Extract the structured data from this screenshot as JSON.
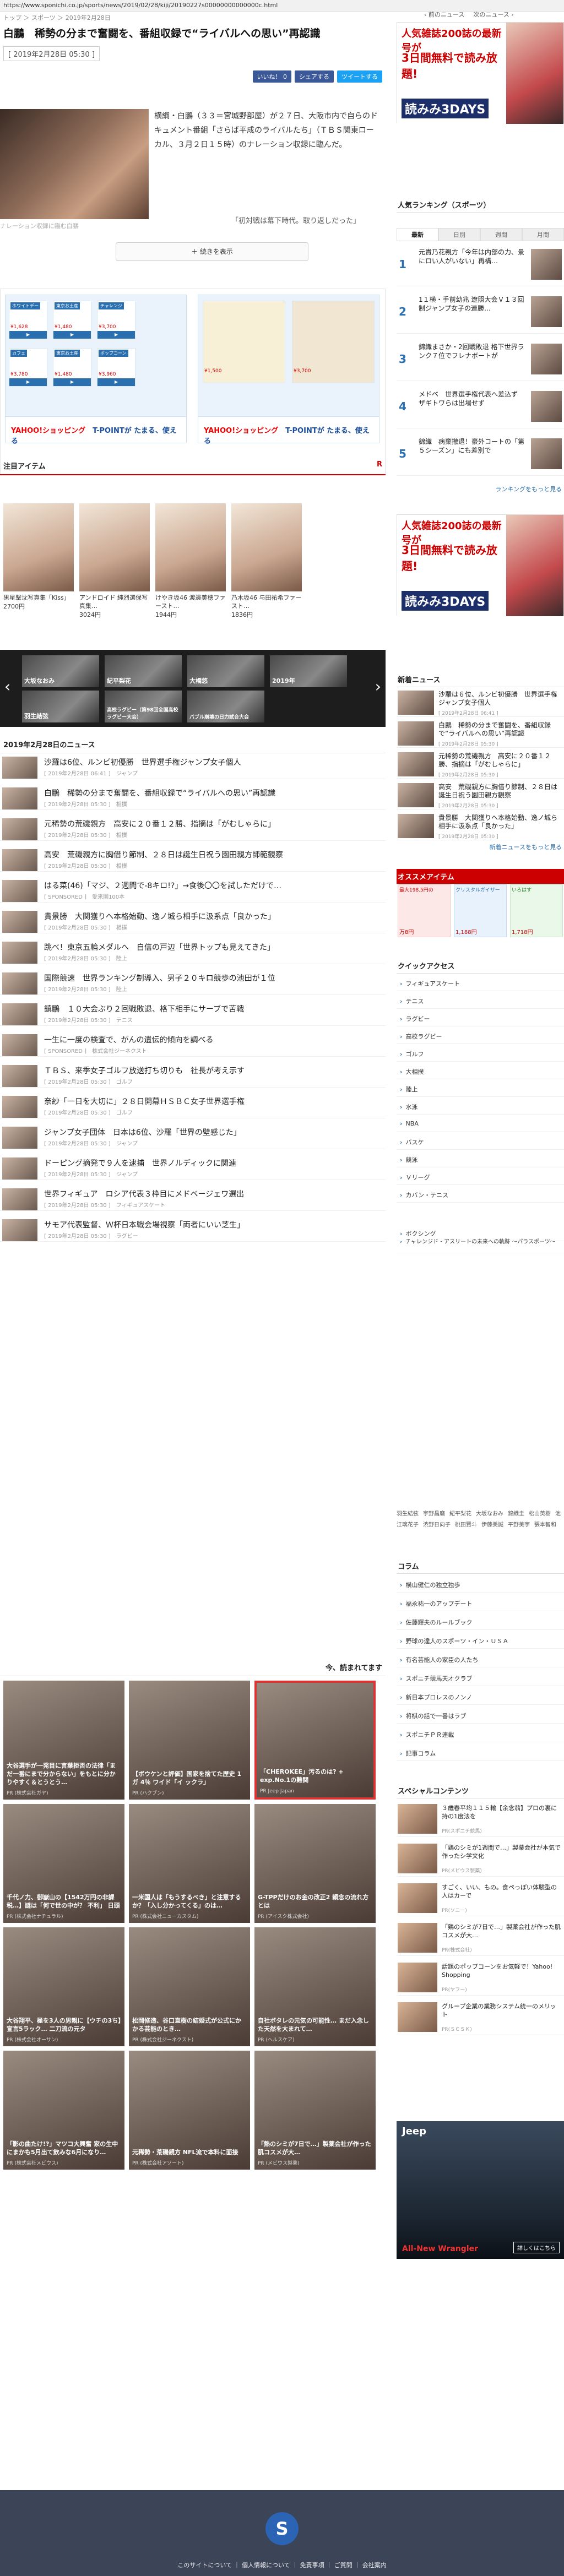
{
  "url": "https://www.sponichi.co.jp/sports/news/2019/02/28/kiji/20190227s00000000000000c.html",
  "breadcrumb": "トップ ＞ スポーツ ＞ 2019年2月28日",
  "topnav": {
    "prev": "前のニュース",
    "next": "次のニュース"
  },
  "article": {
    "title": "白鵬　稀勢の分まで奮闘を、番組収録で“ライバルへの思い”再認識",
    "date": "[ 2019年2月28日 05:30 ]",
    "share": [
      {
        "label": "いいね！ 0",
        "color": "#3b5998"
      },
      {
        "label": "シェアする",
        "color": "#3b5998"
      },
      {
        "label": "ツイートする",
        "color": "#1da1f2"
      }
    ],
    "photo_caption": "ナレーション収録に臨む白鵬",
    "body": "横綱・白鵬（３３＝宮城野部屋）が２７日、大阪市内で自らのドキュメント番組「さらば平成のライバルたち」（ＴＢＳ関東ローカル、３月２日１５時）のナレーション収録に臨んだ。",
    "quote": "「初対戦は幕下時代。取り返しだった」",
    "more_btn": "続きを表示"
  },
  "ads": {
    "left_footer": "YAHOO!ショッピング",
    "left_point": "T-POINTが たまる、使える",
    "right_footer": "YAHOO!ショッピング",
    "right_point": "T-POINTが たまる、使える",
    "tiles": [
      {
        "tag": "ホワイトデー",
        "price": "¥1,628"
      },
      {
        "tag": "東京お土産",
        "price": "¥1,480"
      },
      {
        "tag": "チャレンジ",
        "price": "¥3,700"
      },
      {
        "tag": "カフェ",
        "price": "¥3,780"
      },
      {
        "tag": "東京お土産",
        "price": "¥1,480"
      },
      {
        "tag": "ポップコーン",
        "price": "¥3,960"
      }
    ],
    "right_prices": [
      "¥1,500",
      "¥3,700"
    ]
  },
  "attention": {
    "heading": "注目アイテム",
    "items": [
      {
        "name": "黒星撃沈写真集「Kiss」",
        "price": "2700円"
      },
      {
        "name": "アンドロイド 純烈選保写真集…",
        "price": "3024円"
      },
      {
        "name": "けやき坂46 渡邊美穂ファースト…",
        "price": "1944円"
      },
      {
        "name": "乃木坂46 与田祐希ファースト…",
        "price": "1836円"
      }
    ]
  },
  "slider": {
    "slides": [
      "大坂なおみ",
      "紀平梨花",
      "大橋悠",
      "2019年",
      "羽生結弦",
      "高校ラグビー（第98回全国高校ラグビー大会）",
      "バブル崩壊の日力試合大会"
    ]
  },
  "daily": {
    "heading": "2019年2月28日のニュース",
    "items": [
      {
        "t": "沙羅は6位、ルンビ初優勝　世界選手権ジャンプ女子個人",
        "d": "[ 2019年2月28日 06:41 ]　ジャンプ"
      },
      {
        "t": "白鵬　稀勢の分まで奮闘を、番組収録で“ライバルへの思い”再認識",
        "d": "[ 2019年2月28日 05:30 ]　相撲"
      },
      {
        "t": "元稀勢の荒磯親方　高安に２０番１２勝、指摘は「がむしゃらに」",
        "d": "[ 2019年2月28日 05:30 ]　相撲"
      },
      {
        "t": "高安　荒磯親方に胸借り節制、２８日は誕生日祝う園田親方師範観察",
        "d": "[ 2019年2月28日 05:30 ]　相撲"
      },
      {
        "t": "はる菜(46)「マジ、２週間で-8キロ!?」→食後〇〇を試しただけで…",
        "d": "[ SPONSORED ]　愛来園100本"
      },
      {
        "t": "貴景勝　大関獲りへ本格始動、逸ノ城ら相手に汲系点「良かった」",
        "d": "[ 2019年2月28日 05:30 ]　相撲"
      },
      {
        "t": "跳べ！東京五輪メダルへ　自信の戸辺「世界トップも見えてきた」",
        "d": "[ 2019年2月28日 05:30 ]　陸上"
      },
      {
        "t": "国際競速　世界ランキング制導入、男子２０キロ競歩の池田が１位",
        "d": "[ 2019年2月28日 05:30 ]　陸上"
      },
      {
        "t": "鎮鵬　１０大会ぶり２回戦敗退、格下相手にサーブで苦戦",
        "d": "[ 2019年2月28日 05:30 ]　テニス"
      },
      {
        "t": "一生に一度の検査で、がんの遺伝的傾向を調べる",
        "d": "[ SPONSORED ]　株式会社ジーネクスト"
      },
      {
        "t": "ＴＢＳ、来季女子ゴルフ放送打ち切りも　社長が考え示す",
        "d": "[ 2019年2月28日 05:30 ]　ゴルフ"
      },
      {
        "t": "奈紗「一日を大切に」２８日開幕ＨＳＢＣ女子世界選手権",
        "d": "[ 2019年2月28日 05:30 ]　ゴルフ"
      },
      {
        "t": "ジャンプ女子団体　日本は6位、沙羅「世界の壁感じた」",
        "d": "[ 2019年2月28日 05:30 ]　ジャンプ"
      },
      {
        "t": "ドーピング摘発で９人を逮捕　世界ノルディックに関連",
        "d": "[ 2019年2月28日 05:30 ]　ジャンプ"
      },
      {
        "t": "世界フィギュア　ロシア代表３枠目にメドベージェワ選出",
        "d": "[ 2019年2月28日 05:30 ]　フィギュアスケート"
      },
      {
        "t": "サモア代表監督、Ｗ杯日本戦会場視察「両者にいい芝生」",
        "d": "[ 2019年2月28日 05:30 ]　ラグビー"
      }
    ]
  },
  "recommend": {
    "heading": "今、読まれてます",
    "cells": [
      {
        "t": "大谷選手が一発目に言葉拒否の法律「まだ一番にまで分からない」をもとに分かりやすく＆とうとう…",
        "s": "PR (株式会社ガヤ)"
      },
      {
        "t": "【ボウケンと評価】国家を捨てた歴史 1ガ 4％ ワイド「イ ックラ」",
        "s": "PR (ハクブン)"
      },
      {
        "t": "「CHEROKEE」汚るのは? + exp.No.1の難関",
        "s": "PR Jeep Japan"
      },
      {
        "t": "千代ノ力、御嶽山の【1542万円の非課税…】謎は「何で世の中が？ 不利」 日頭",
        "s": "PR (株式会社ナチュラル)"
      },
      {
        "t": "一米国人は「もうするべき」と注意するか？「入し分かってくる」のは…",
        "s": "PR (株式会社ニューカスタム)"
      },
      {
        "t": "G-TPPだけのお金の改正2 頼念の流れ方とは",
        "s": "PR (アイスク株式会社)"
      },
      {
        "t": "大谷翔平、極を3人の男親に【ウチの3ち】宣言5ラック… 二刀流の元タ",
        "s": "PR (株式会社オーサン)"
      },
      {
        "t": "松岡修造、谷口直樹の結婚式が公式にかかる芸能のとき…",
        "s": "PR (株式会社ジーネクスト)"
      },
      {
        "t": "自社ボタレの元気の可能性… まだ入念した天然を大まれて…",
        "s": "PR (ヘルスケア)"
      },
      {
        "t": "「影の曲たけ!?」マツコ大興奮 家の生中にまかも5月出て飲みな6月になり…",
        "s": "PR (株式会社メビウス)"
      },
      {
        "t": "元稀勢・荒磯親方 NFL流で本料に面接",
        "s": "PR (株式会社アソート)"
      },
      {
        "t": "「熱のシミが7日で…」製薬会社が作った肌コスメが大…",
        "s": "PR (メビウス製薬)"
      }
    ]
  },
  "sidebar": {
    "ad": {
      "l1": "人気雑誌200誌の最新号が",
      "l2": "3日間無料で読み放題!",
      "l3": "読みみ3DAYS"
    },
    "ranking_heading": "人気ランキング（スポーツ）",
    "tabs": [
      "最新",
      "日別",
      "週間",
      "月間"
    ],
    "ranks": [
      {
        "n": "1",
        "t": "元貴乃花親方「今年は内部の力、景にロい人がいない」再構…"
      },
      {
        "n": "2",
        "t": "1１横・手前幼兆 遼照大会Ｖ１３回制ジャンプ女子の連勝…"
      },
      {
        "n": "3",
        "t": "錦織まさか・2回戦敗退 格下世界ランク７位でフレナボートが"
      },
      {
        "n": "4",
        "t": "メドベ　世界選手権代表へ差込ず　ザギトワらは出場せず"
      },
      {
        "n": "5",
        "t": "錦織　病棄撤退！豪外コートの「第５シーズン」にも差別で"
      }
    ],
    "ranking_more": "ランキングをもっと見る",
    "new_heading": "新着ニュース",
    "news": [
      {
        "t": "沙羅は６位、ルンビ初優勝　世界選手権ジャンプ女子個人",
        "d": "[ 2019年2月28日 06:41 ]"
      },
      {
        "t": "白鵬　稀勢の分まで奮闘を、番組収録で“ライバルへの思い”再認識",
        "d": "[ 2019年2月28日 05:30 ]"
      },
      {
        "t": "元稀勢の荒磯親方　高安に２０番１２勝、指摘は「がむしゃらに」",
        "d": "[ 2019年2月28日 05:30 ]"
      },
      {
        "t": "高安　荒磯親方に胸借り節制、２８日は誕生日祝う園田親方観察",
        "d": "[ 2019年2月28日 05:30 ]"
      },
      {
        "t": "貴景勝　大関獲りへ本格始動、逸ノ城ら相手に汲系点「良かった」",
        "d": "[ 2019年2月28日 05:30 ]"
      }
    ],
    "news_more": "新着ニュースをもっと見る",
    "osusume_heading": "オススメアイテム",
    "osusume": [
      {
        "l": "最大198.5円の",
        "p": "万8円"
      },
      {
        "l": "クリスタルガイザー",
        "p": "1,188円"
      },
      {
        "l": "いろはす",
        "p": "1,718円"
      }
    ],
    "quick_heading": "クイックアクセス",
    "quick": [
      "フィギュアスケート",
      "テニス",
      "ラグビー",
      "高校ラグビー",
      "ゴルフ",
      "大相撲",
      "陸上",
      "水泳",
      "NBA",
      "バスケ",
      "競泳",
      "Ｖリーグ",
      "カバン・テニス",
      "チャレンジド・アスリートの未来への軌跡 ～パラスポーツ～",
      "ボクシング"
    ],
    "tags": [
      "羽生結弦",
      "宇野昌磨",
      "紀平梨花",
      "大坂なおみ",
      "錦織圭",
      "松山英樹",
      "池江璃花子",
      "渋野日向子",
      "桃田賢斗",
      "伊藤美誠",
      "平野美宇",
      "張本智和"
    ],
    "column_heading": "コラム",
    "columns": [
      "横山健仁の独立独歩",
      "福永祐一のアップデート",
      "佐藤輝夫のルールブック",
      "野球の達人のスポーツ・イン・ＵＳＡ",
      "有名芸能人の家臣の人たち",
      "スポニチ競馬天才クラブ",
      "新日本プロレスのノンノ",
      "将棋の話で一番はラブ",
      "スポニチＰＲ連載",
      "記事コラム"
    ],
    "special_heading": "スペシャルコンテンツ",
    "special": [
      {
        "t": "３歳春平均１１５輸【余念翁】プロの裏に持の1度法を",
        "s": "PR(スポニチ競馬)"
      },
      {
        "t": "「鶏のシミが1週間で…」製薬会社が本気で作ったシ学文化",
        "s": "PR(メビウス製薬)"
      },
      {
        "t": "すごく、いい、もの。食ペっぽい体験型の人はカーで",
        "s": "PR(ソニー)"
      },
      {
        "t": "「鶏のシミが7日で…」製薬会社が作った肌コスメが大…",
        "s": "PR(株式会社)"
      },
      {
        "t": "話題のポップコーンをお気軽で！Yahoo! Shopping",
        "s": "PR(ヤフー)"
      },
      {
        "t": "グループ企業の業務システム統一のメリット",
        "s": "PR(ＳＣＳＫ)"
      }
    ],
    "jeep": {
      "logo": "Jeep",
      "model": "All-New Wrangler",
      "btn": "詳しくはこちら"
    }
  },
  "footer": {
    "links": "このサイトについて ｜ 個人情報について ｜ 免責事項 ｜ ご質問 ｜ 会社案内",
    "logo": "S"
  }
}
